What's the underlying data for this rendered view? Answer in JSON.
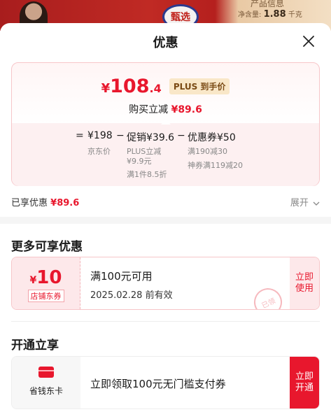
{
  "backdrop": {
    "badge_text": "甄选",
    "info_title": "产品信息",
    "info_label": "净含量:",
    "info_value": "1.88",
    "info_unit": "千克"
  },
  "sheet": {
    "title": "优惠"
  },
  "price_card": {
    "currency": "¥",
    "price_int": "108",
    "price_dec": ".4",
    "plus_tag": "PLUS 到手价",
    "reduce_label": "购买立减",
    "reduce_amount": "¥89.6",
    "formula": {
      "eq": "=",
      "jd_price": "¥198",
      "minus1": "−",
      "promo": "促销¥39.6",
      "minus2": "−",
      "coupon": "优惠券¥50",
      "jd_price_label": "京东价",
      "promo_sub1": "PLUS立减",
      "promo_sub2": "¥9.9元",
      "promo_sub3": "满1件8.5折",
      "coupon_sub1": "满190减30",
      "coupon_sub2": "神券满119减20"
    }
  },
  "enjoy": {
    "label": "已享优惠",
    "amount": "¥89.6",
    "expand_label": "展开"
  },
  "more_section": {
    "title": "更多可享优惠"
  },
  "store_coupon": {
    "currency": "¥",
    "amount": "10",
    "tag": "店铺东券",
    "condition": "满100元可用",
    "expiry": "2025.02.28 前有效",
    "stamp": "已领",
    "button_line1": "立即",
    "button_line2": "使用"
  },
  "open_section": {
    "title": "开通立享"
  },
  "vip_card": {
    "name": "省钱东卡",
    "offer": "立即领取100元无门槛支付券",
    "button_line1": "立即",
    "button_line2": "开通"
  },
  "colors": {
    "accent": "#e8172d",
    "plus_tag_bg": "#f9e7c8",
    "coupon_bg": "#fde8ea"
  },
  "icons": {
    "close": "close-icon",
    "expand": "chevron-down-icon",
    "card": "card-icon"
  }
}
